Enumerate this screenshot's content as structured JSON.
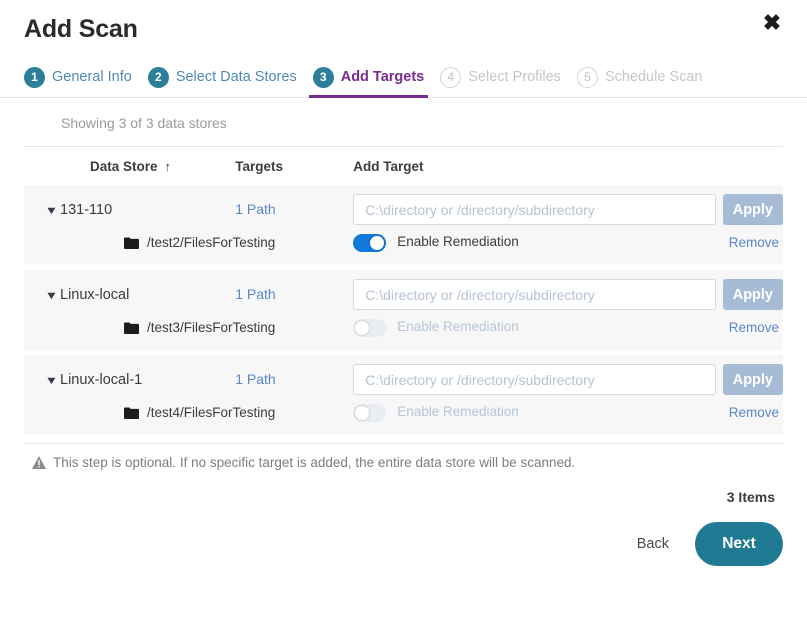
{
  "dialog": {
    "title": "Add Scan",
    "close_icon": "close-x-icon"
  },
  "stepper": {
    "steps": [
      {
        "num": "1",
        "label": "General Info",
        "state": "complete"
      },
      {
        "num": "2",
        "label": "Select Data Stores",
        "state": "complete"
      },
      {
        "num": "3",
        "label": "Add Targets",
        "state": "active"
      },
      {
        "num": "4",
        "label": "Select Profiles",
        "state": "disabled"
      },
      {
        "num": "5",
        "label": "Schedule Scan",
        "state": "disabled"
      }
    ],
    "active_color": "#7b2d8e",
    "complete_color": "#2d7f99"
  },
  "main": {
    "showing_text": "Showing 3 of 3 data stores",
    "columns": {
      "data_store": "Data Store",
      "sort_arrow": "↑",
      "targets": "Targets",
      "add_target": "Add Target"
    },
    "input_placeholder": "C:\\directory or /directory/subdirectory",
    "apply_label": "Apply",
    "remediation_label": "Enable Remediation",
    "remove_label": "Remove",
    "rows": [
      {
        "name": "131-110",
        "paths": "1 Path",
        "input_value": "",
        "target_path": "/test2/FilesForTesting",
        "remediation_on": true
      },
      {
        "name": "Linux-local",
        "paths": "1 Path",
        "input_value": "",
        "target_path": "/test3/FilesForTesting",
        "remediation_on": false
      },
      {
        "name": "Linux-local-1",
        "paths": "1 Path",
        "input_value": "",
        "target_path": "/test4/FilesForTesting",
        "remediation_on": false
      }
    ],
    "note": "This step is optional. If no specific target is added, the entire data store will be scanned.",
    "items_count": "3 Items"
  },
  "footer": {
    "back_label": "Back",
    "next_label": "Next",
    "next_color": "#217a93"
  }
}
